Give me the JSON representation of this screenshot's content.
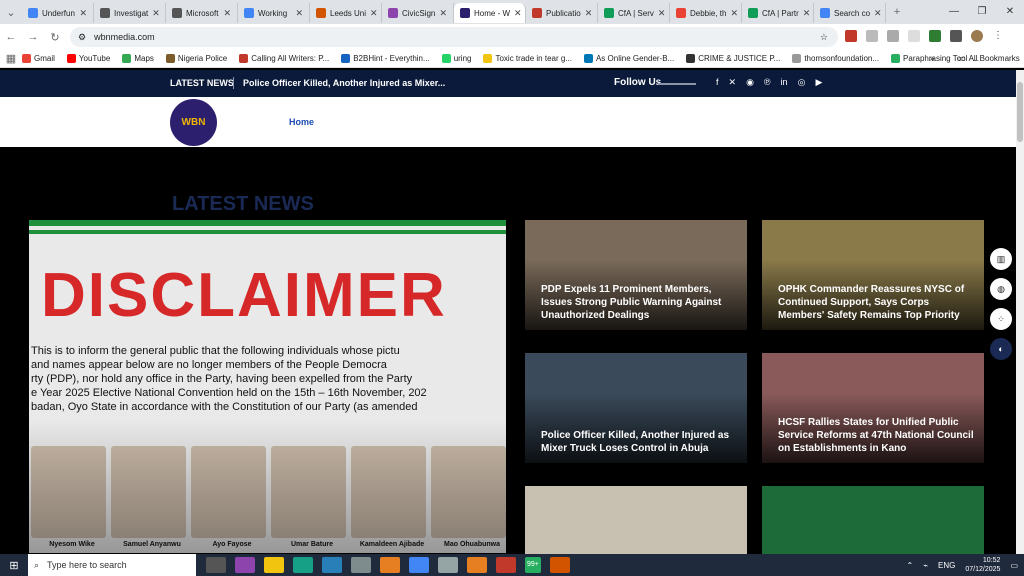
{
  "browser": {
    "tabs": [
      {
        "label": "Underfun",
        "color": "#4285f4"
      },
      {
        "label": "Investigat",
        "color": "#555555"
      },
      {
        "label": "Microsoft",
        "color": "#555555"
      },
      {
        "label": "Working",
        "color": "#4285f4"
      },
      {
        "label": "Leeds Uni",
        "color": "#d35400"
      },
      {
        "label": "CivicSign",
        "color": "#8e44ad"
      },
      {
        "label": "Home - W",
        "color": "#2b1f6e"
      },
      {
        "label": "Publicatio",
        "color": "#c0392b"
      },
      {
        "label": "CfA | Serv",
        "color": "#0f9d58"
      },
      {
        "label": "Debbie, th",
        "color": "#ea4335"
      },
      {
        "label": "CfA | Partr",
        "color": "#0f9d58"
      },
      {
        "label": "Search co",
        "color": "#4285f4"
      }
    ],
    "url": "wbnmedia.com",
    "bookmarks": [
      {
        "label": "Gmail",
        "color": "#ea4335"
      },
      {
        "label": "YouTube",
        "color": "#ff0000"
      },
      {
        "label": "Maps",
        "color": "#34a853"
      },
      {
        "label": "Nigeria Police",
        "color": "#7b5c2a"
      },
      {
        "label": "Calling All Writers: P...",
        "color": "#c0392b"
      },
      {
        "label": "B2BHint - Everythin...",
        "color": "#1565c0"
      },
      {
        "label": "uring",
        "color": "#25d366"
      },
      {
        "label": "Toxic trade in tear g...",
        "color": "#f1c40f"
      },
      {
        "label": "As Online Gender-B...",
        "color": "#0077b5"
      },
      {
        "label": "CRIME & JUSTICE P...",
        "color": "#333333"
      },
      {
        "label": "thomsonfoundation...",
        "color": "#999999"
      },
      {
        "label": "Paraphrasing Tool -...",
        "color": "#27ae60"
      }
    ],
    "all_bookmarks": "All Bookmarks"
  },
  "site": {
    "latest_label": "LATEST NEWS",
    "ticker": "Police Officer Killed, Another Injured as Mixer...",
    "follow_us": "Follow Us",
    "logo_text": "WBN",
    "nav_home": "Home",
    "section_title": "LATEST NEWS",
    "hero": {
      "headline": "DISCLAIMER",
      "body_lines": [
        "This is to inform the general public that the following individuals whose pictu",
        "and names appear below are no longer members of the People Democra",
        "rty (PDP), nor hold any office in the Party, having been expelled from the Party",
        "e Year 2025 Elective National Convention held on the 15th – 16th November, 202",
        "badan, Oyo State in accordance with the Constitution of our Party (as amended"
      ],
      "faces": [
        "Nyesom Wike",
        "Samuel Anyanwu",
        "Ayo Fayose",
        "Umar Bature",
        "Kamaldeen Ajibade",
        "Mao Ohuabunwa"
      ]
    },
    "cards": [
      {
        "title": "PDP Expels 11 Prominent Members, Issues Strong Public Warning Against Unauthorized Dealings",
        "color": "#7a6a5a"
      },
      {
        "title": "OPHK Commander Reassures NYSC of Continued Support, Says Corps Members' Safety Remains Top Priority",
        "color": "#8a7a4a"
      },
      {
        "title": "Police Officer Killed, Another Injured as Mixer Truck Loses Control in Abuja",
        "color": "#3a4a5a"
      },
      {
        "title": "HCSF Rallies States for Unified Public Service Reforms at 47th National Council on Establishments in Kano",
        "color": "#8a5a5a"
      },
      {
        "title": "",
        "color": "#c8c0b0"
      },
      {
        "title": "",
        "color": "#1e6b3a"
      }
    ]
  },
  "taskbar": {
    "search_placeholder": "Type here to search",
    "lang": "ENG",
    "time": "10:52",
    "date": "07/12/2025",
    "badge": "99+"
  }
}
